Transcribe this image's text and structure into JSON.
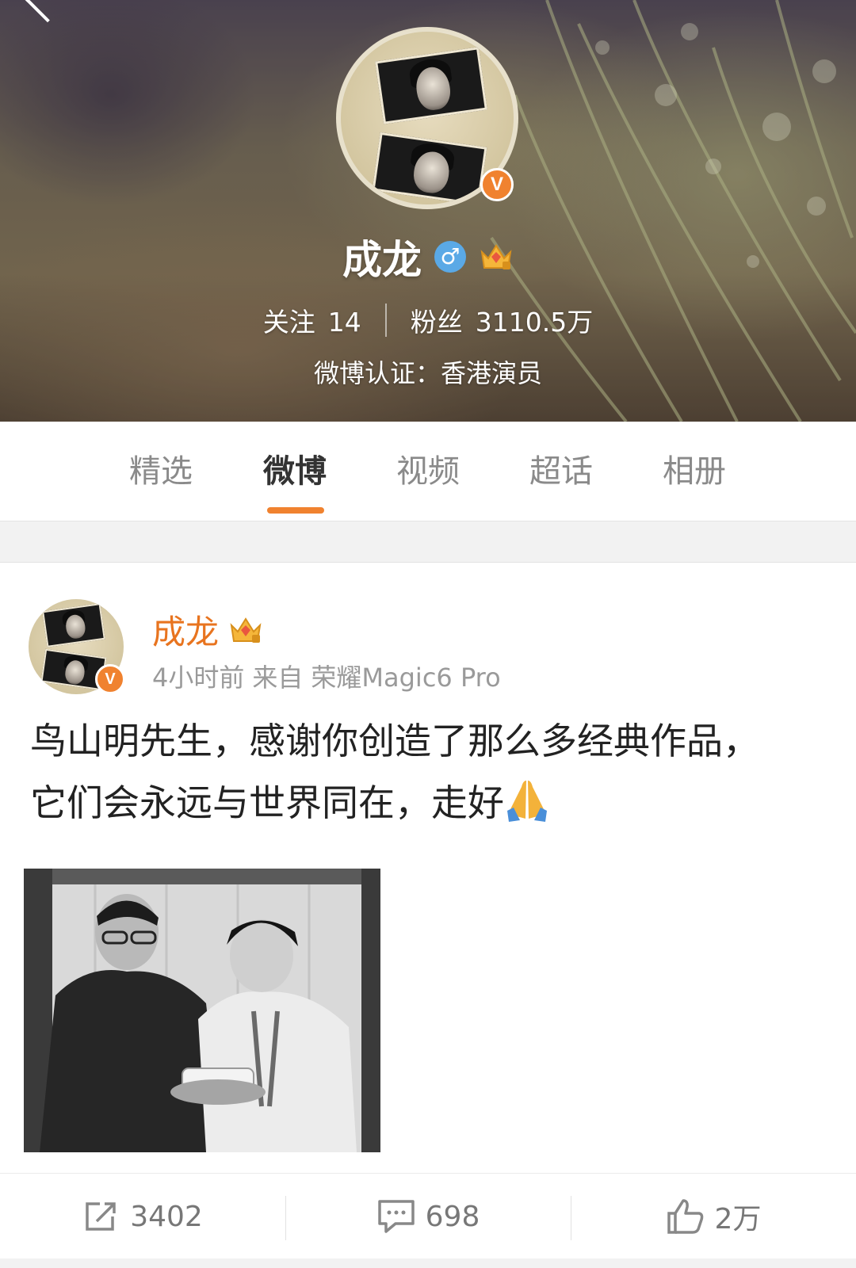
{
  "profile": {
    "name": "成龙",
    "following_label": "关注",
    "following_count": "14",
    "fans_label": "粉丝",
    "fans_count": "3110.5万",
    "verification": "微博认证：香港演员",
    "verified_badge": "V"
  },
  "tabs": [
    {
      "label": "精选"
    },
    {
      "label": "微博",
      "active": true
    },
    {
      "label": "视频"
    },
    {
      "label": "超话"
    },
    {
      "label": "相册"
    }
  ],
  "post": {
    "author": "成龙",
    "time": "4小时前",
    "source_prefix": "来自",
    "source": "荣耀Magic6 Pro",
    "text": "鸟山明先生，感谢你创造了那么多经典作品，它们会永远与世界同在，走好",
    "verified_badge": "V"
  },
  "actions": {
    "repost_count": "3402",
    "comment_count": "698",
    "like_count": "2万"
  },
  "colors": {
    "accent": "#f0822f",
    "author_name": "#e8741f",
    "gender_badge": "#5aa9e6"
  },
  "icons": [
    "back-arrow-icon",
    "verified-icon",
    "male-gender-icon",
    "crown-level-icon",
    "praying-hands-icon",
    "repost-icon",
    "comment-icon",
    "like-icon"
  ]
}
